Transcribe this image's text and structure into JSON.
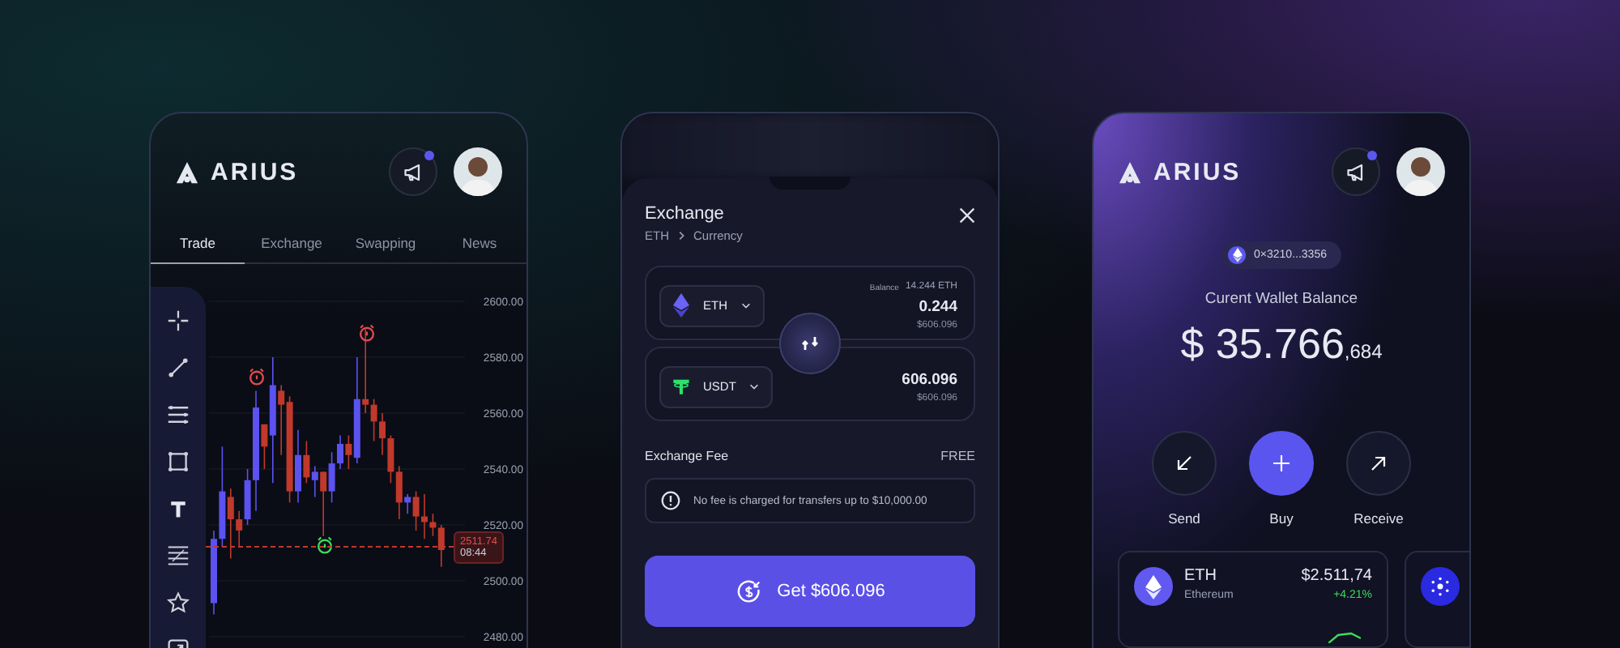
{
  "trade_screen": {
    "logo": "ARIUS",
    "notifications": {
      "unread": true
    },
    "tabs": [
      {
        "label": "Trade",
        "selected": true
      },
      {
        "label": "Exchange",
        "selected": false
      },
      {
        "label": "Swapping",
        "selected": false
      },
      {
        "label": "News",
        "selected": false
      }
    ],
    "chart_data": {
      "type": "candlestick",
      "grid": true,
      "ylim": [
        2480,
        2600
      ],
      "ohlc": [
        [
          2492,
          2518,
          2488,
          2515
        ],
        [
          2515,
          2548,
          2512,
          2532
        ],
        [
          2530,
          2533,
          2508,
          2522
        ],
        [
          2522,
          2525,
          2512,
          2518
        ],
        [
          2522,
          2540,
          2520,
          2536
        ],
        [
          2536,
          2568,
          2525,
          2562
        ],
        [
          2556,
          2556,
          2540,
          2548
        ],
        [
          2552,
          2580,
          2535,
          2570
        ],
        [
          2568,
          2570,
          2545,
          2563
        ],
        [
          2564,
          2566,
          2528,
          2532
        ],
        [
          2532,
          2554,
          2528,
          2545
        ],
        [
          2545,
          2550,
          2535,
          2537
        ],
        [
          2536,
          2541,
          2530,
          2539
        ],
        [
          2539,
          2539,
          2516,
          2532
        ],
        [
          2532,
          2546,
          2528,
          2542
        ],
        [
          2542,
          2552,
          2540,
          2549
        ],
        [
          2549,
          2552,
          2540,
          2545
        ],
        [
          2544,
          2580,
          2542,
          2565
        ],
        [
          2565,
          2590,
          2560,
          2563
        ],
        [
          2563,
          2565,
          2550,
          2557
        ],
        [
          2557,
          2560,
          2545,
          2551
        ],
        [
          2551,
          2552,
          2535,
          2539
        ],
        [
          2539,
          2541,
          2522,
          2528
        ],
        [
          2528,
          2531,
          2524,
          2530
        ],
        [
          2530,
          2532,
          2518,
          2523
        ],
        [
          2523,
          2531,
          2515,
          2521
        ],
        [
          2521,
          2524,
          2516,
          2519
        ],
        [
          2519,
          2520,
          2505,
          2511
        ]
      ],
      "yticks": [
        {
          "value": 2600,
          "label": "2600.00"
        },
        {
          "value": 2580,
          "label": "2580.00"
        },
        {
          "value": 2560,
          "label": "2560.00"
        },
        {
          "value": 2540,
          "label": "2540.00"
        },
        {
          "value": 2520,
          "label": "2520.00"
        },
        {
          "value": 2500,
          "label": "2500.00"
        },
        {
          "value": 2480,
          "label": "2480.00"
        }
      ]
    },
    "price_tag": {
      "price": "2511.74",
      "time": "08:44"
    }
  },
  "exchange_screen": {
    "title": "Exchange",
    "breadcrumb": [
      "ETH",
      "Currency"
    ],
    "from": {
      "token": "ETH",
      "balance_label": "Balance",
      "balance": "14.244 ETH",
      "amount": "0.244",
      "value": "$606.096"
    },
    "to": {
      "token": "USDT",
      "amount": "606.096",
      "value": "$606.096"
    },
    "fee": {
      "label": "Exchange Fee",
      "value": "FREE"
    },
    "notice": "No fee is charged for transfers up to $10,000.00",
    "button": "Get $606.096"
  },
  "wallet_screen": {
    "logo": "ARIUS",
    "notifications": {
      "unread": true
    },
    "address": "0×3210...3356",
    "balance_label": "Curent Wallet Balance",
    "balance_main": "$ 35.766",
    "balance_decimals": ",684",
    "actions": [
      {
        "label": "Send",
        "kind": "secondary"
      },
      {
        "label": "Buy",
        "kind": "primary"
      },
      {
        "label": "Receive",
        "kind": "secondary"
      }
    ],
    "tokens": [
      {
        "symbol": "ETH",
        "name": "Ethereum",
        "price": "$2.511,74",
        "change": "+4.21%"
      }
    ]
  }
}
